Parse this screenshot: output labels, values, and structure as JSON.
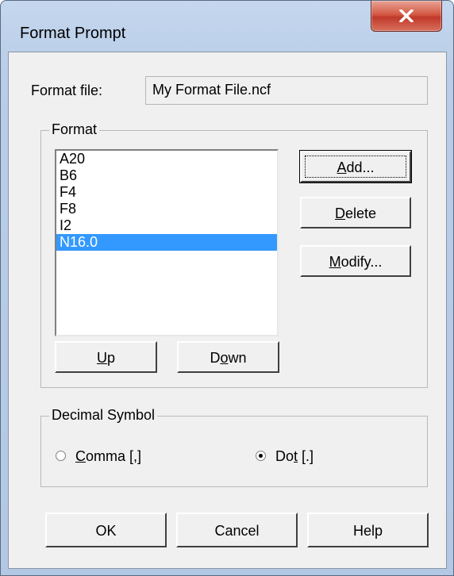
{
  "window": {
    "title": "Format Prompt"
  },
  "format_file": {
    "label": "Format file:",
    "value": "My Format File.ncf"
  },
  "format_group": {
    "legend": "Format",
    "items": [
      "A20",
      "B6",
      "F4",
      "F8",
      "I2",
      "N16.0"
    ],
    "selected_index": 5,
    "buttons": {
      "add": "Add...",
      "delete": "Delete",
      "modify": "Modify...",
      "up": "Up",
      "down": "Down"
    }
  },
  "decimal_group": {
    "legend": "Decimal Symbol",
    "options": [
      {
        "label": "Comma [,]",
        "checked": false
      },
      {
        "label": "Dot [.]",
        "checked": true
      }
    ]
  },
  "footer": {
    "ok": "OK",
    "cancel": "Cancel",
    "help": "Help"
  },
  "icons": {
    "close": "close-x-icon"
  },
  "colors": {
    "selection": "#3399ff",
    "close_button": "#c0392b"
  }
}
